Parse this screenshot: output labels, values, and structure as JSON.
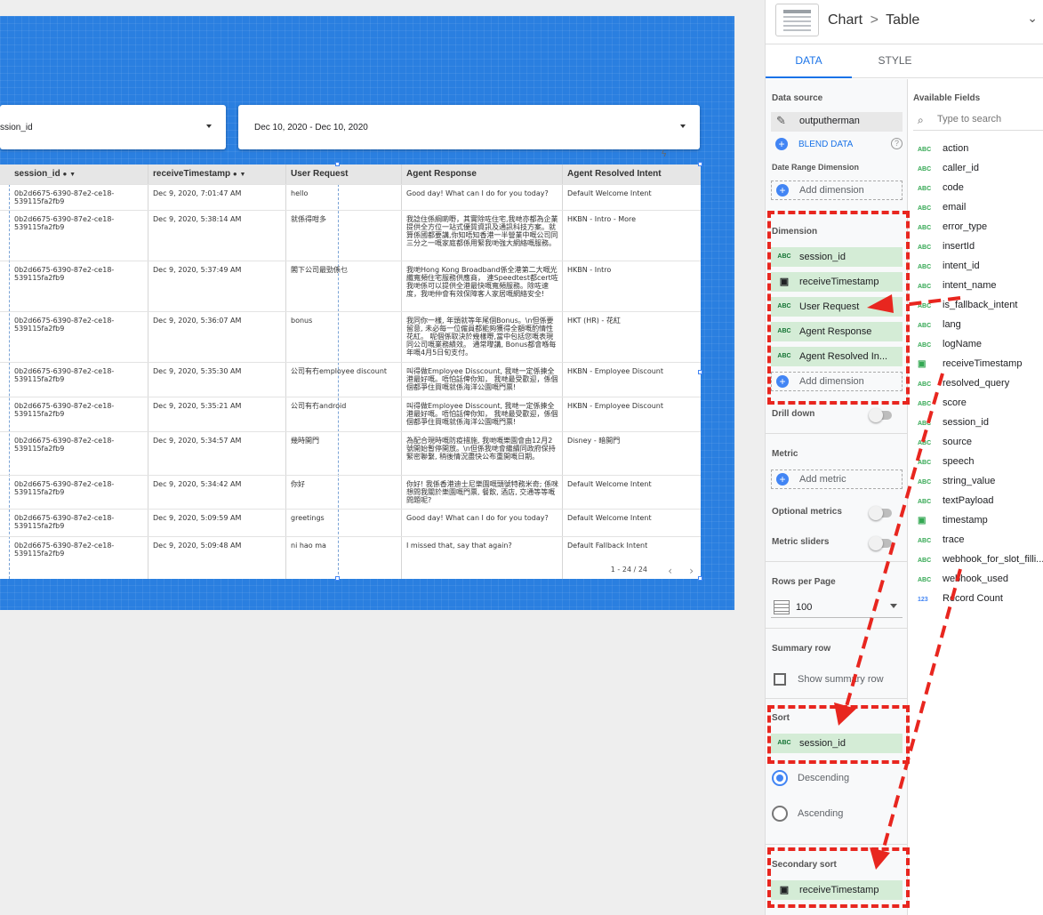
{
  "controls": {
    "session_filter": "ssion_id",
    "date_range": "Dec 10, 2020 - Dec 10, 2020"
  },
  "table": {
    "headers": [
      "session_id",
      "receiveTimestamp",
      "User Request",
      "Agent Response",
      "Agent Resolved Intent"
    ],
    "rows": [
      {
        "session": "0b2d6675-6390-87e2-ce18-539115fa2fb9",
        "ts": "Dec 9, 2020, 7:01:47 AM",
        "req": "hello",
        "resp": "Good day! What can I do for you today?",
        "intent": "Default Welcome Intent"
      },
      {
        "session": "0b2d6675-6390-87e2-ce18-539115fa2fb9",
        "ts": "Dec 9, 2020, 5:38:14 AM",
        "req": "就係得咁多",
        "resp": "我諗住係綱啲嘢，其實除咗住宅,我哋亦都為企業提供全方位一站式優質資訊及通訊科技方案。就算係國都要講,你知唔知香港一半營業中嘅公司同三分之一嘅家庭都係用緊我哋強大網絡嘅服務。",
        "intent": "HKBN - Intro - More"
      },
      {
        "session": "0b2d6675-6390-87e2-ce18-539115fa2fb9",
        "ts": "Dec 9, 2020, 5:37:49 AM",
        "req": "閣下公司最勁係乜",
        "resp": "我哋Hong Kong Broadband係全港第二大嘅光纖寬頻住宅服務供應商， 連Speedtest都cert咗我哋係可以提供全港最快嘅寬頻服務。除咗速度，我哋仲會有效保障客人家居嘅網絡安全!",
        "intent": "HKBN - Intro"
      },
      {
        "session": "0b2d6675-6390-87e2-ce18-539115fa2fb9",
        "ts": "Dec 9, 2020, 5:36:07 AM",
        "req": "bonus",
        "resp": "我同你一樣, 年頭就等年尾個Bonus。\\n但係要留意, 未必每一位僱員都能夠獲得全額嘅酌情性花紅。 呢個係取決於幾樣嘢,當中包括您嘅表現同公司嘅業務績效。 通常嚟講, Bonus都會喺每年嘅4月5日旬支付。",
        "intent": "HKT (HR) - 花紅"
      },
      {
        "session": "0b2d6675-6390-87e2-ce18-539115fa2fb9",
        "ts": "Dec 9, 2020, 5:35:30 AM",
        "req": "公司有冇employee discount",
        "resp": "叫得做Employee Disscount, 我哋一定係揀全港最好嘅。唔怕話俾你知， 我哋最受歡迎，係個個都爭住買嘅就係海洋公園嘅門票!",
        "intent": "HKBN - Employee Discount"
      },
      {
        "session": "0b2d6675-6390-87e2-ce18-539115fa2fb9",
        "ts": "Dec 9, 2020, 5:35:21 AM",
        "req": "公司有冇android",
        "resp": "叫得做Employee Disscount, 我哋一定係揀全港最好嘅。唔怕話俾你知， 我哋最受歡迎，係個個都爭住買嘅就係海洋公園嘅門票!",
        "intent": "HKBN - Employee Discount"
      },
      {
        "session": "0b2d6675-6390-87e2-ce18-539115fa2fb9",
        "ts": "Dec 9, 2020, 5:34:57 AM",
        "req": "幾時開門",
        "resp": "為配合現時嘅防疫措施, 我哋嘅樂園會由12月2號開始暫停開放。\\n但係我哋會繼續同政府保持緊密聯繫, 稍後情況盡快公布重開嘅日期。",
        "intent": "Disney - 暗開門"
      },
      {
        "session": "0b2d6675-6390-87e2-ce18-539115fa2fb9",
        "ts": "Dec 9, 2020, 5:34:42 AM",
        "req": "你好",
        "resp": "你好! 我係香港迪士尼樂園嘅頭號特務米奇; 係咪想問我關於樂園嘅門票, 餐飲, 酒店, 交通等等嘅問題呢?",
        "intent": "Default Welcome Intent"
      },
      {
        "session": "0b2d6675-6390-87e2-ce18-539115fa2fb9",
        "ts": "Dec 9, 2020, 5:09:59 AM",
        "req": "greetings",
        "resp": "Good day! What can I do for you today?",
        "intent": "Default Welcome Intent"
      },
      {
        "session": "0b2d6675-6390-87e2-ce18-539115fa2fb9",
        "ts": "Dec 9, 2020, 5:09:48 AM",
        "req": "ni hao ma",
        "resp": "I missed that, say that again?",
        "intent": "Default Fallback Intent"
      }
    ],
    "pager": "1 - 24 / 24"
  },
  "panel": {
    "crumb_chart": "Chart",
    "crumb_sep": ">",
    "crumb_table": "Table",
    "tabs": [
      "DATA",
      "STYLE"
    ],
    "data_source_title": "Data source",
    "data_source": "outputherman",
    "blend": "BLEND DATA",
    "date_range_dim_title": "Date Range Dimension",
    "add_dimension": "Add dimension",
    "dimension_title": "Dimension",
    "dimensions": [
      {
        "icon": "ABC",
        "label": "session_id"
      },
      {
        "icon": "calendar",
        "label": "receiveTimestamp"
      },
      {
        "icon": "ABC",
        "label": "User Request"
      },
      {
        "icon": "ABC",
        "label": "Agent Response"
      },
      {
        "icon": "ABC",
        "label": "Agent Resolved In..."
      }
    ],
    "drill_down": "Drill down",
    "metric_title": "Metric",
    "add_metric": "Add metric",
    "optional_metrics": "Optional metrics",
    "metric_sliders": "Metric sliders",
    "rows_per_page_title": "Rows per Page",
    "rows_per_page": "100",
    "summary_row_title": "Summary row",
    "show_summary_row": "Show summary row",
    "sort_title": "Sort",
    "sort_field": "session_id",
    "descending": "Descending",
    "ascending": "Ascending",
    "secondary_sort_title": "Secondary sort",
    "secondary_sort_field": "receiveTimestamp",
    "available_fields_title": "Available Fields",
    "search_placeholder": "Type to search",
    "fields": [
      {
        "icon": "ABC",
        "label": "action"
      },
      {
        "icon": "ABC",
        "label": "caller_id"
      },
      {
        "icon": "ABC",
        "label": "code"
      },
      {
        "icon": "ABC",
        "label": "email"
      },
      {
        "icon": "ABC",
        "label": "error_type"
      },
      {
        "icon": "ABC",
        "label": "insertId"
      },
      {
        "icon": "ABC",
        "label": "intent_id"
      },
      {
        "icon": "ABC",
        "label": "intent_name"
      },
      {
        "icon": "ABC",
        "label": "is_fallback_intent"
      },
      {
        "icon": "ABC",
        "label": "lang"
      },
      {
        "icon": "ABC",
        "label": "logName"
      },
      {
        "icon": "calendar",
        "label": "receiveTimestamp"
      },
      {
        "icon": "ABC",
        "label": "resolved_query"
      },
      {
        "icon": "ABC",
        "label": "score"
      },
      {
        "icon": "ABC",
        "label": "session_id"
      },
      {
        "icon": "ABC",
        "label": "source"
      },
      {
        "icon": "ABC",
        "label": "speech"
      },
      {
        "icon": "ABC",
        "label": "string_value"
      },
      {
        "icon": "ABC",
        "label": "textPayload"
      },
      {
        "icon": "calendar",
        "label": "timestamp"
      },
      {
        "icon": "ABC",
        "label": "trace"
      },
      {
        "icon": "ABC",
        "label": "webhook_for_slot_filli..."
      },
      {
        "icon": "ABC",
        "label": "webhook_used"
      },
      {
        "icon": "123",
        "label": "Record Count"
      }
    ]
  }
}
